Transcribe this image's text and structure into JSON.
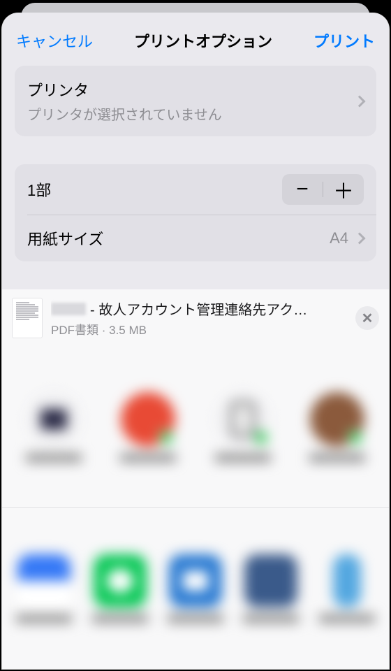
{
  "nav": {
    "cancel": "キャンセル",
    "title": "プリントオプション",
    "print": "プリント"
  },
  "printer": {
    "label": "プリンタ",
    "status": "プリンタが選択されていません"
  },
  "copies": {
    "label": "1部",
    "minus": "−",
    "plus": "＋"
  },
  "paper": {
    "label": "用紙サイズ",
    "value": "A4"
  },
  "file": {
    "name_suffix": " - 故人アカウント管理連絡先アク…",
    "meta_type": "PDF書類",
    "meta_sep": " · ",
    "meta_size": "3.5 MB",
    "close": "✕"
  }
}
